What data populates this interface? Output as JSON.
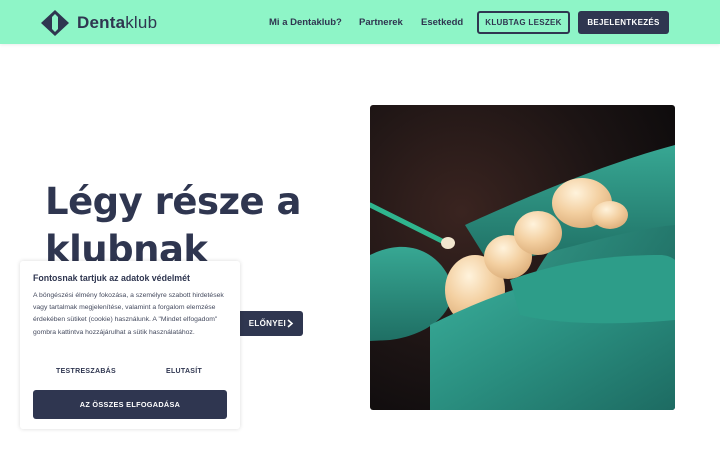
{
  "header": {
    "logo": {
      "bold": "Denta",
      "rest": "klub",
      "icon": "dentaklub-logo-icon"
    },
    "nav": [
      "Mi a Dentaklub?",
      "Partnerek",
      "Esetkedd"
    ],
    "join_button": "KLUBTAG LESZEK",
    "login_button": "BEJELENTKEZÉS"
  },
  "hero": {
    "title": "Légy része a klubnak",
    "cta_label": "ELŐNYEI",
    "cta_icon": "chevron-right-icon",
    "image_description": "dental-crown-in-gloved-hand"
  },
  "cookie": {
    "title": "Fontosnak tartjuk az adatok védelmét",
    "text": "A böngészési élmény fokozása, a személyre szabott hirdetések vagy tartalmak megjelenítése, valamint a forgalom elemzése érdekében sütiket (cookie) használunk. A \"Mindet elfogadom\" gombra kattintva hozzájárulhat a sütik használatához.",
    "customize": "TESTRESZABÁS",
    "reject": "ELUTASÍT",
    "accept_all": "AZ ÖSSZES ELFOGADÁSA"
  },
  "colors": {
    "header_bg": "#8ef5c7",
    "navy": "#2f3650",
    "glove_green": "#2f9a8a"
  }
}
